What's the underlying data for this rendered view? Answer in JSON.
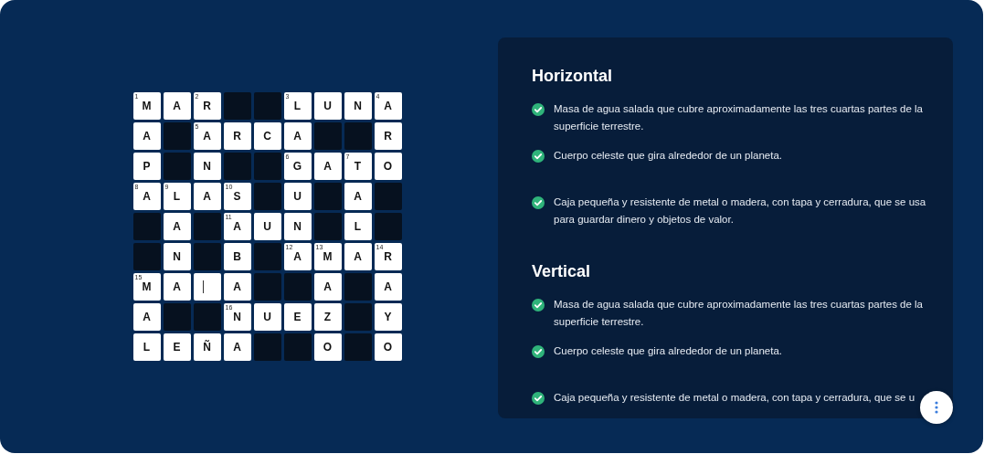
{
  "crossword": {
    "rows": [
      [
        {
          "kind": "letter",
          "letter": "M",
          "number": "1"
        },
        {
          "kind": "letter",
          "letter": "A"
        },
        {
          "kind": "letter",
          "letter": "R",
          "number": "2"
        },
        {
          "kind": "block"
        },
        {
          "kind": "block"
        },
        {
          "kind": "letter",
          "letter": "L",
          "number": "3"
        },
        {
          "kind": "letter",
          "letter": "U"
        },
        {
          "kind": "letter",
          "letter": "N"
        },
        {
          "kind": "letter",
          "letter": "A",
          "number": "4"
        }
      ],
      [
        {
          "kind": "letter",
          "letter": "A"
        },
        {
          "kind": "block"
        },
        {
          "kind": "letter",
          "letter": "A",
          "number": "5"
        },
        {
          "kind": "letter",
          "letter": "R"
        },
        {
          "kind": "letter",
          "letter": "C"
        },
        {
          "kind": "letter",
          "letter": "A"
        },
        {
          "kind": "block"
        },
        {
          "kind": "block"
        },
        {
          "kind": "letter",
          "letter": "R"
        }
      ],
      [
        {
          "kind": "letter",
          "letter": "P"
        },
        {
          "kind": "block"
        },
        {
          "kind": "letter",
          "letter": "N"
        },
        {
          "kind": "block"
        },
        {
          "kind": "block"
        },
        {
          "kind": "letter",
          "letter": "G",
          "number": "6"
        },
        {
          "kind": "letter",
          "letter": "A"
        },
        {
          "kind": "letter",
          "letter": "T",
          "number": "7"
        },
        {
          "kind": "letter",
          "letter": "O"
        }
      ],
      [
        {
          "kind": "letter",
          "letter": "A",
          "number": "8"
        },
        {
          "kind": "letter",
          "letter": "L",
          "number": "9"
        },
        {
          "kind": "letter",
          "letter": "A"
        },
        {
          "kind": "letter",
          "letter": "S",
          "number": "10"
        },
        {
          "kind": "block"
        },
        {
          "kind": "letter",
          "letter": "U"
        },
        {
          "kind": "block"
        },
        {
          "kind": "letter",
          "letter": "A"
        },
        {
          "kind": "block"
        }
      ],
      [
        {
          "kind": "block"
        },
        {
          "kind": "letter",
          "letter": "A"
        },
        {
          "kind": "block"
        },
        {
          "kind": "letter",
          "letter": "A",
          "number": "11"
        },
        {
          "kind": "letter",
          "letter": "U"
        },
        {
          "kind": "letter",
          "letter": "N"
        },
        {
          "kind": "block"
        },
        {
          "kind": "letter",
          "letter": "L"
        },
        {
          "kind": "block"
        }
      ],
      [
        {
          "kind": "block"
        },
        {
          "kind": "letter",
          "letter": "N"
        },
        {
          "kind": "block"
        },
        {
          "kind": "letter",
          "letter": "B"
        },
        {
          "kind": "block"
        },
        {
          "kind": "letter",
          "letter": "A",
          "number": "12"
        },
        {
          "kind": "letter",
          "letter": "M",
          "number": "13"
        },
        {
          "kind": "letter",
          "letter": "A"
        },
        {
          "kind": "letter",
          "letter": "R",
          "number": "14"
        }
      ],
      [
        {
          "kind": "letter",
          "letter": "M",
          "number": "15"
        },
        {
          "kind": "letter",
          "letter": "A"
        },
        {
          "kind": "empty",
          "focused": true
        },
        {
          "kind": "letter",
          "letter": "A"
        },
        {
          "kind": "block"
        },
        {
          "kind": "block"
        },
        {
          "kind": "letter",
          "letter": "A"
        },
        {
          "kind": "block"
        },
        {
          "kind": "letter",
          "letter": "A"
        }
      ],
      [
        {
          "kind": "letter",
          "letter": "A"
        },
        {
          "kind": "block"
        },
        {
          "kind": "block"
        },
        {
          "kind": "letter",
          "letter": "N",
          "number": "16"
        },
        {
          "kind": "letter",
          "letter": "U"
        },
        {
          "kind": "letter",
          "letter": "E"
        },
        {
          "kind": "letter",
          "letter": "Z"
        },
        {
          "kind": "block"
        },
        {
          "kind": "letter",
          "letter": "Y"
        }
      ],
      [
        {
          "kind": "letter",
          "letter": "L"
        },
        {
          "kind": "letter",
          "letter": "E"
        },
        {
          "kind": "letter",
          "letter": "Ñ"
        },
        {
          "kind": "letter",
          "letter": "A"
        },
        {
          "kind": "block"
        },
        {
          "kind": "block"
        },
        {
          "kind": "letter",
          "letter": "O"
        },
        {
          "kind": "block"
        },
        {
          "kind": "letter",
          "letter": "O"
        }
      ]
    ]
  },
  "clue_sections": [
    {
      "title": "Horizontal",
      "clues": [
        {
          "text": "Masa de agua salada que cubre aproximadamente las tres cuartas partes de la superficie terrestre.",
          "checked": true
        },
        {
          "text": "Cuerpo celeste que gira alrededor de un planeta.",
          "checked": true
        },
        {
          "text": "Caja pequeña y resistente de metal o madera, con tapa y cerradura, que se usa para guardar dinero y objetos de valor.",
          "checked": true
        }
      ]
    },
    {
      "title": "Vertical",
      "clues": [
        {
          "text": "Masa de agua salada que cubre aproximadamente las tres cuartas partes de la superficie terrestre.",
          "checked": true
        },
        {
          "text": "Cuerpo celeste que gira alrededor de un planeta.",
          "checked": true
        },
        {
          "text": "Caja pequeña y resistente de metal o madera, con tapa y cerradura, que se u",
          "checked": true
        }
      ]
    }
  ]
}
